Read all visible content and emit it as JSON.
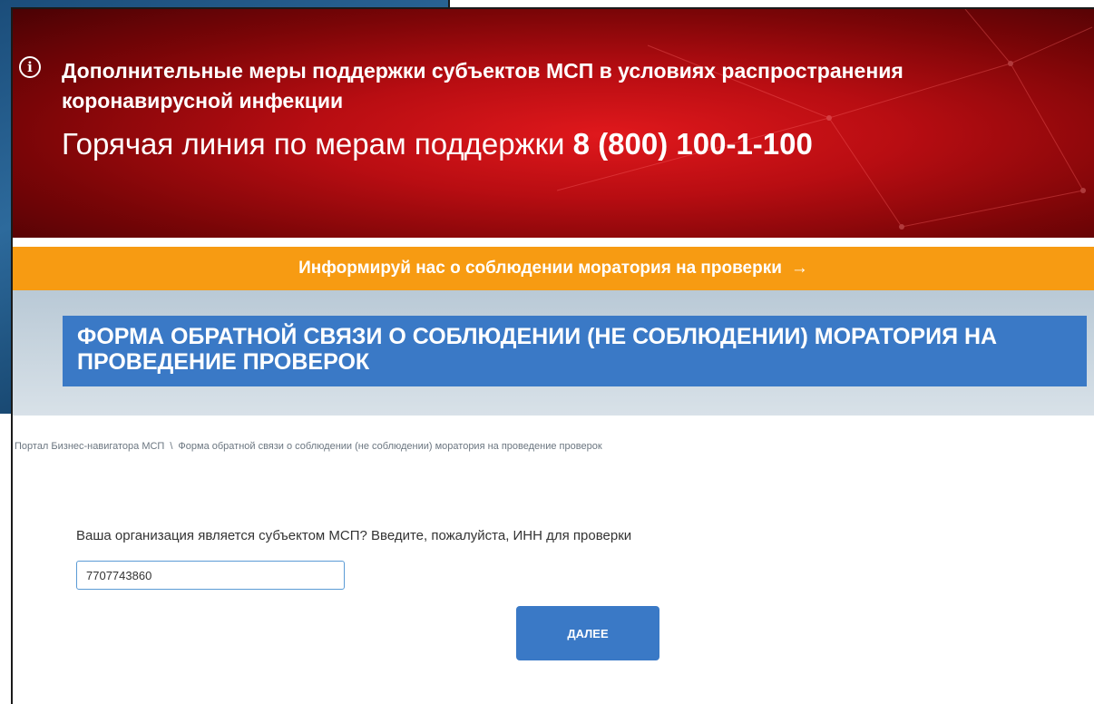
{
  "banner": {
    "info_icon": "info-icon",
    "title": "Дополнительные меры поддержки субъектов МСП в условиях распространения коронавирусной инфекции",
    "hotline_text": "Горячая линия по мерам поддержки ",
    "hotline_phone": "8 (800) 100-1-100"
  },
  "promo": {
    "text": "Информируй нас о соблюдении моратория на проверки",
    "arrow": "→",
    "color": "#f79b12"
  },
  "page_title": "ФОРМА ОБРАТНОЙ СВЯЗИ О СОБЛЮДЕНИИ (НЕ СОБЛЮДЕНИИ) МОРАТОРИЯ НА ПРОВЕДЕНИЕ ПРОВЕРОК",
  "breadcrumb": {
    "items": [
      "Портал Бизнес-навигатора МСП",
      "Форма обратной связи о соблюдении (не соблюдении) моратория на проведение проверок"
    ],
    "separator": "\\"
  },
  "form": {
    "question": "Ваша организация является субъектом МСП? Введите, пожалуйста, ИНН для проверки",
    "inn_value": "7707743860",
    "submit_label": "ДАЛЕЕ"
  },
  "colors": {
    "accent_blue": "#3a79c6",
    "banner_red": "#b80d12"
  }
}
